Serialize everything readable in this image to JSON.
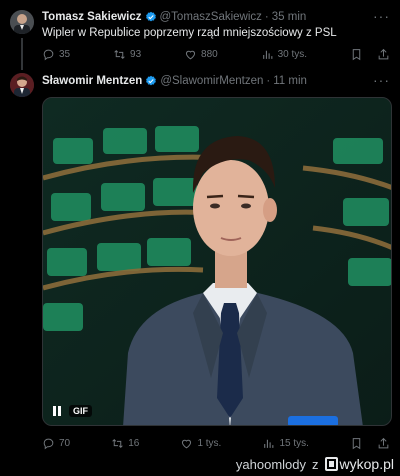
{
  "tweet1": {
    "name": "Tomasz Sakiewicz",
    "handle": "@TomaszSakiewicz",
    "time": "35 min",
    "text": "Wipler w Republice poprzemy rząd mniejszościowy z PSL",
    "replies": "35",
    "retweets": "93",
    "likes": "880",
    "views": "30 tys."
  },
  "tweet2": {
    "name": "Sławomir Mentzen",
    "handle": "@SlawomirMentzen",
    "time": "11 min",
    "media_badge": "GIF",
    "replies": "70",
    "retweets": "16",
    "likes": "1 tys.",
    "views": "15 tys."
  },
  "footer": {
    "username": "yahoomlody",
    "separator": "z",
    "site": "wykop.pl"
  },
  "colors": {
    "background": "#000000",
    "text": "#e7e9ea",
    "secondary": "#71767b",
    "verified": "#1d9bf0"
  },
  "icons": [
    "verified-icon",
    "more-icon",
    "reply-icon",
    "retweet-icon",
    "like-icon",
    "views-icon",
    "bookmark-icon",
    "share-icon",
    "pause-icon",
    "wykop-logo-icon"
  ]
}
